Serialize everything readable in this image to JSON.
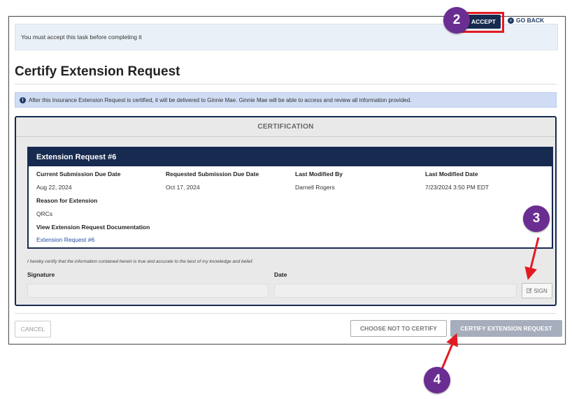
{
  "banner": {
    "message": "You must accept this task before completing it",
    "accept_label": "ACCEPT",
    "go_back_label": "GO BACK"
  },
  "page": {
    "title": "Certify Extension Request",
    "info_text": "After this Insurance Extension Request is certified, it will be delivered to Ginnie Mae. Ginnie Mae will be able to access and review all information provided."
  },
  "certification": {
    "header": "CERTIFICATION",
    "request_title": "Extension Request #6",
    "fields": {
      "current_due_label": "Current Submission Due Date",
      "current_due_value": "Aug 22, 2024",
      "requested_due_label": "Requested Submission Due Date",
      "requested_due_value": "Oct 17, 2024",
      "modified_by_label": "Last Modified By",
      "modified_by_value": "Darnell Rogers",
      "modified_date_label": "Last Modified Date",
      "modified_date_value": "7/23/2024 3:50 PM EDT",
      "reason_label": "Reason for Extension",
      "reason_value": "QRCs",
      "documentation_label": "View Extension Request Documentation",
      "documentation_link": "Extension Request #6"
    },
    "attestation": "I hereby certify that the information contained herein is true and accurate to the best of my knowledge and belief.",
    "signature_label": "Signature",
    "date_label": "Date",
    "sign_label": "SIGN"
  },
  "footer": {
    "cancel_label": "CANCEL",
    "not_certify_label": "CHOOSE NOT TO CERTIFY",
    "certify_label": "CERTIFY EXTENSION REQUEST"
  },
  "callouts": {
    "step2": "2",
    "step3": "3",
    "step4": "4",
    "badge_color": "#6a2d91",
    "highlight_color": "#e21b23"
  },
  "icons": {
    "accept": "download-icon",
    "go_back": "arrow-left-circle-icon",
    "info": "info-circle-icon",
    "sign": "edit-icon"
  }
}
